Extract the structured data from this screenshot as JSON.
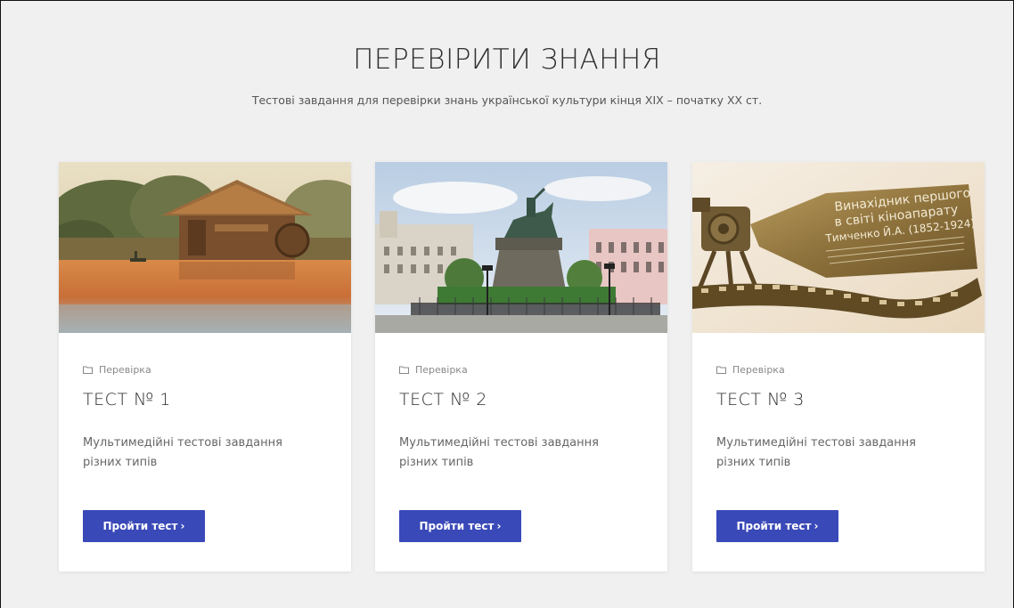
{
  "section": {
    "title": "ПЕРЕВІРИТИ ЗНАННЯ",
    "subtitle": "Тестові завдання для перевірки знань української культури кінця ХІХ – початку ХХ ст."
  },
  "cards": [
    {
      "image": "landscape-painting-watermill",
      "category": "Перевірка",
      "title": "ТЕСТ № 1",
      "description": "Мультимедійні тестові завдання різних типів",
      "button_label": "Пройти тест",
      "button_icon": "chevron-right-icon"
    },
    {
      "image": "equestrian-monument-square",
      "category": "Перевірка",
      "title": "ТЕСТ № 2",
      "description": "Мультимедійні тестові завдання різних типів",
      "button_label": "Пройти тест",
      "button_icon": "chevron-right-icon"
    },
    {
      "image": "memorial-plaque-film-projector",
      "category": "Перевірка",
      "title": "ТЕСТ № 3",
      "description": "Мультимедійні тестові завдання різних типів",
      "button_label": "Пройти тест",
      "button_icon": "chevron-right-icon",
      "plaque_text": [
        "Винахідник першого",
        "в світі кіноапарату",
        "Тимченко Й.А. (1852-1924)"
      ]
    }
  ],
  "colors": {
    "background": "#f0f0f0",
    "card": "#ffffff",
    "button": "#3a49b8"
  }
}
